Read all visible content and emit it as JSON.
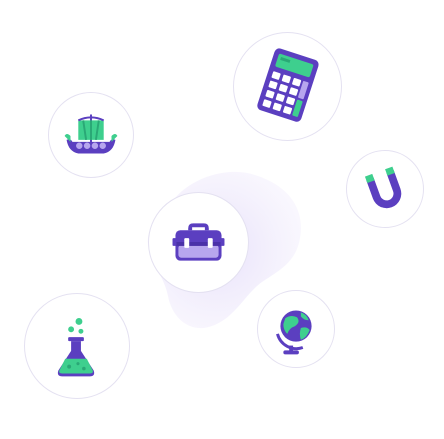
{
  "colors": {
    "purple": "#5b3fc0",
    "purple_light": "#7c5fd8",
    "purple_pale": "#b7a6ee",
    "green": "#3ecf8e",
    "green_dark": "#2aa876",
    "blob": "#ece7fa",
    "ring": "#e4e1f1"
  },
  "icons": [
    {
      "name": "viking-ship-icon"
    },
    {
      "name": "calculator-icon"
    },
    {
      "name": "magnet-icon"
    },
    {
      "name": "briefcase-icon"
    },
    {
      "name": "globe-icon"
    },
    {
      "name": "flask-icon"
    }
  ]
}
